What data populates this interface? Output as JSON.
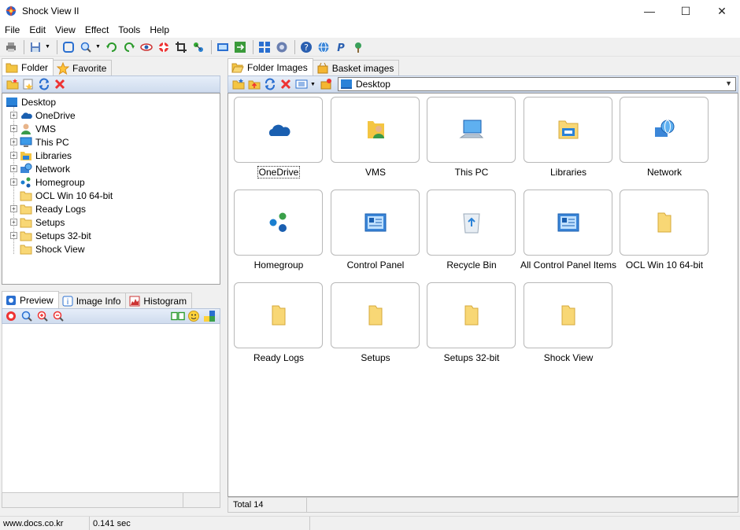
{
  "window": {
    "title": "Shock View II",
    "minimize": "—",
    "maximize": "☐",
    "close": "✕"
  },
  "menu": [
    "File",
    "Edit",
    "View",
    "Effect",
    "Tools",
    "Help"
  ],
  "left_tabs": [
    {
      "label": "Folder"
    },
    {
      "label": "Favorite"
    }
  ],
  "tree": {
    "root": "Desktop",
    "items": [
      {
        "label": "OneDrive",
        "icon": "onedrive-icon"
      },
      {
        "label": "VMS",
        "icon": "user-folder-icon"
      },
      {
        "label": "This PC",
        "icon": "computer-icon"
      },
      {
        "label": "Libraries",
        "icon": "libraries-icon"
      },
      {
        "label": "Network",
        "icon": "network-icon"
      },
      {
        "label": "Homegroup",
        "icon": "homegroup-icon"
      },
      {
        "label": "OCL Win 10 64-bit",
        "icon": "folder-icon"
      },
      {
        "label": "Ready Logs",
        "icon": "folder-icon"
      },
      {
        "label": "Setups",
        "icon": "folder-icon"
      },
      {
        "label": "Setups 32-bit",
        "icon": "folder-icon"
      },
      {
        "label": "Shock View",
        "icon": "folder-icon"
      }
    ]
  },
  "preview_tabs": [
    {
      "label": "Preview"
    },
    {
      "label": "Image Info"
    },
    {
      "label": "Histogram"
    }
  ],
  "right_tabs": [
    {
      "label": "Folder Images"
    },
    {
      "label": "Basket images"
    }
  ],
  "address": {
    "value": "Desktop"
  },
  "thumbnails": [
    {
      "label": "OneDrive",
      "icon": "onedrive-icon"
    },
    {
      "label": "VMS",
      "icon": "user-folder-icon"
    },
    {
      "label": "This PC",
      "icon": "computer-icon"
    },
    {
      "label": "Libraries",
      "icon": "libraries-icon"
    },
    {
      "label": "Network",
      "icon": "network-icon"
    },
    {
      "label": "Homegroup",
      "icon": "homegroup-icon"
    },
    {
      "label": "Control Panel",
      "icon": "control-panel-icon"
    },
    {
      "label": "Recycle Bin",
      "icon": "recycle-bin-icon"
    },
    {
      "label": "All Control Panel Items",
      "icon": "control-panel-icon"
    },
    {
      "label": "OCL Win 10 64-bit",
      "icon": "folder-icon"
    },
    {
      "label": "Ready Logs",
      "icon": "folder-icon"
    },
    {
      "label": "Setups",
      "icon": "folder-icon"
    },
    {
      "label": "Setups 32-bit",
      "icon": "folder-icon"
    },
    {
      "label": "Shock View",
      "icon": "folder-icon"
    }
  ],
  "right_status": {
    "total": "Total 14"
  },
  "statusbar": {
    "website": "www.docs.co.kr",
    "time": "0.141 sec"
  }
}
